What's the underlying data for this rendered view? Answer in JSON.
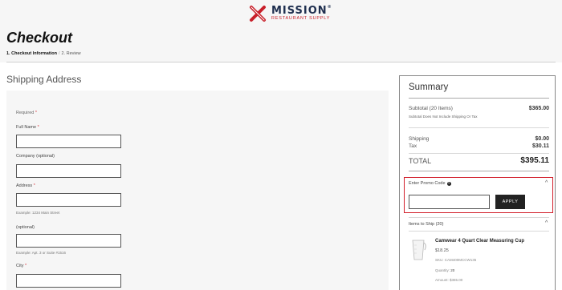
{
  "header": {
    "brand_main": "MISSION",
    "brand_reg": "®",
    "brand_sub": "RESTAURANT SUPPLY",
    "brand_colors": {
      "navy": "#1f2f4f",
      "red": "#c8202a"
    }
  },
  "page": {
    "title": "Checkout",
    "breadcrumb_step1": "1. Checkout Information",
    "breadcrumb_sep": "/",
    "breadcrumb_step2": "2. Review"
  },
  "shipping": {
    "section_title": "Shipping Address",
    "required_note": "Required",
    "required_marker": "*",
    "fields": {
      "full_name": {
        "label": "Full Name",
        "value": ""
      },
      "company": {
        "label": "Company (optional)",
        "value": ""
      },
      "address": {
        "label": "Address",
        "value": "",
        "hint": "Example: 1234 Main Street"
      },
      "address2": {
        "label": "(optional)",
        "value": "",
        "hint": "Example: Apt. 3 or Suite #1516"
      },
      "city": {
        "label": "City",
        "value": ""
      }
    }
  },
  "summary": {
    "title": "Summary",
    "subtotal_label": "Subtotal (20 Items)",
    "subtotal_value": "$365.00",
    "subtotal_note": "Subtotal Does Not Include Shipping Or Tax",
    "shipping_label": "Shipping",
    "shipping_value": "$0.00",
    "tax_label": "Tax",
    "tax_value": "$30.11",
    "total_label": "TOTAL",
    "total_value": "$395.11",
    "promo_label": "Enter Promo Code",
    "promo_value": "",
    "apply_label": "APPLY",
    "items_label": "Items to Ship (20)",
    "item": {
      "name": "Camwear 4 Quart Clear Measuring Cup",
      "price": "$18.25",
      "sku_label": "SKU:",
      "sku_value": "CAM400MCCW135",
      "qty_label": "Quantity:",
      "qty_value": "20",
      "amount_label": "Amount:",
      "amount_value": "$365.00"
    },
    "accent_color": "#d21f2b"
  }
}
